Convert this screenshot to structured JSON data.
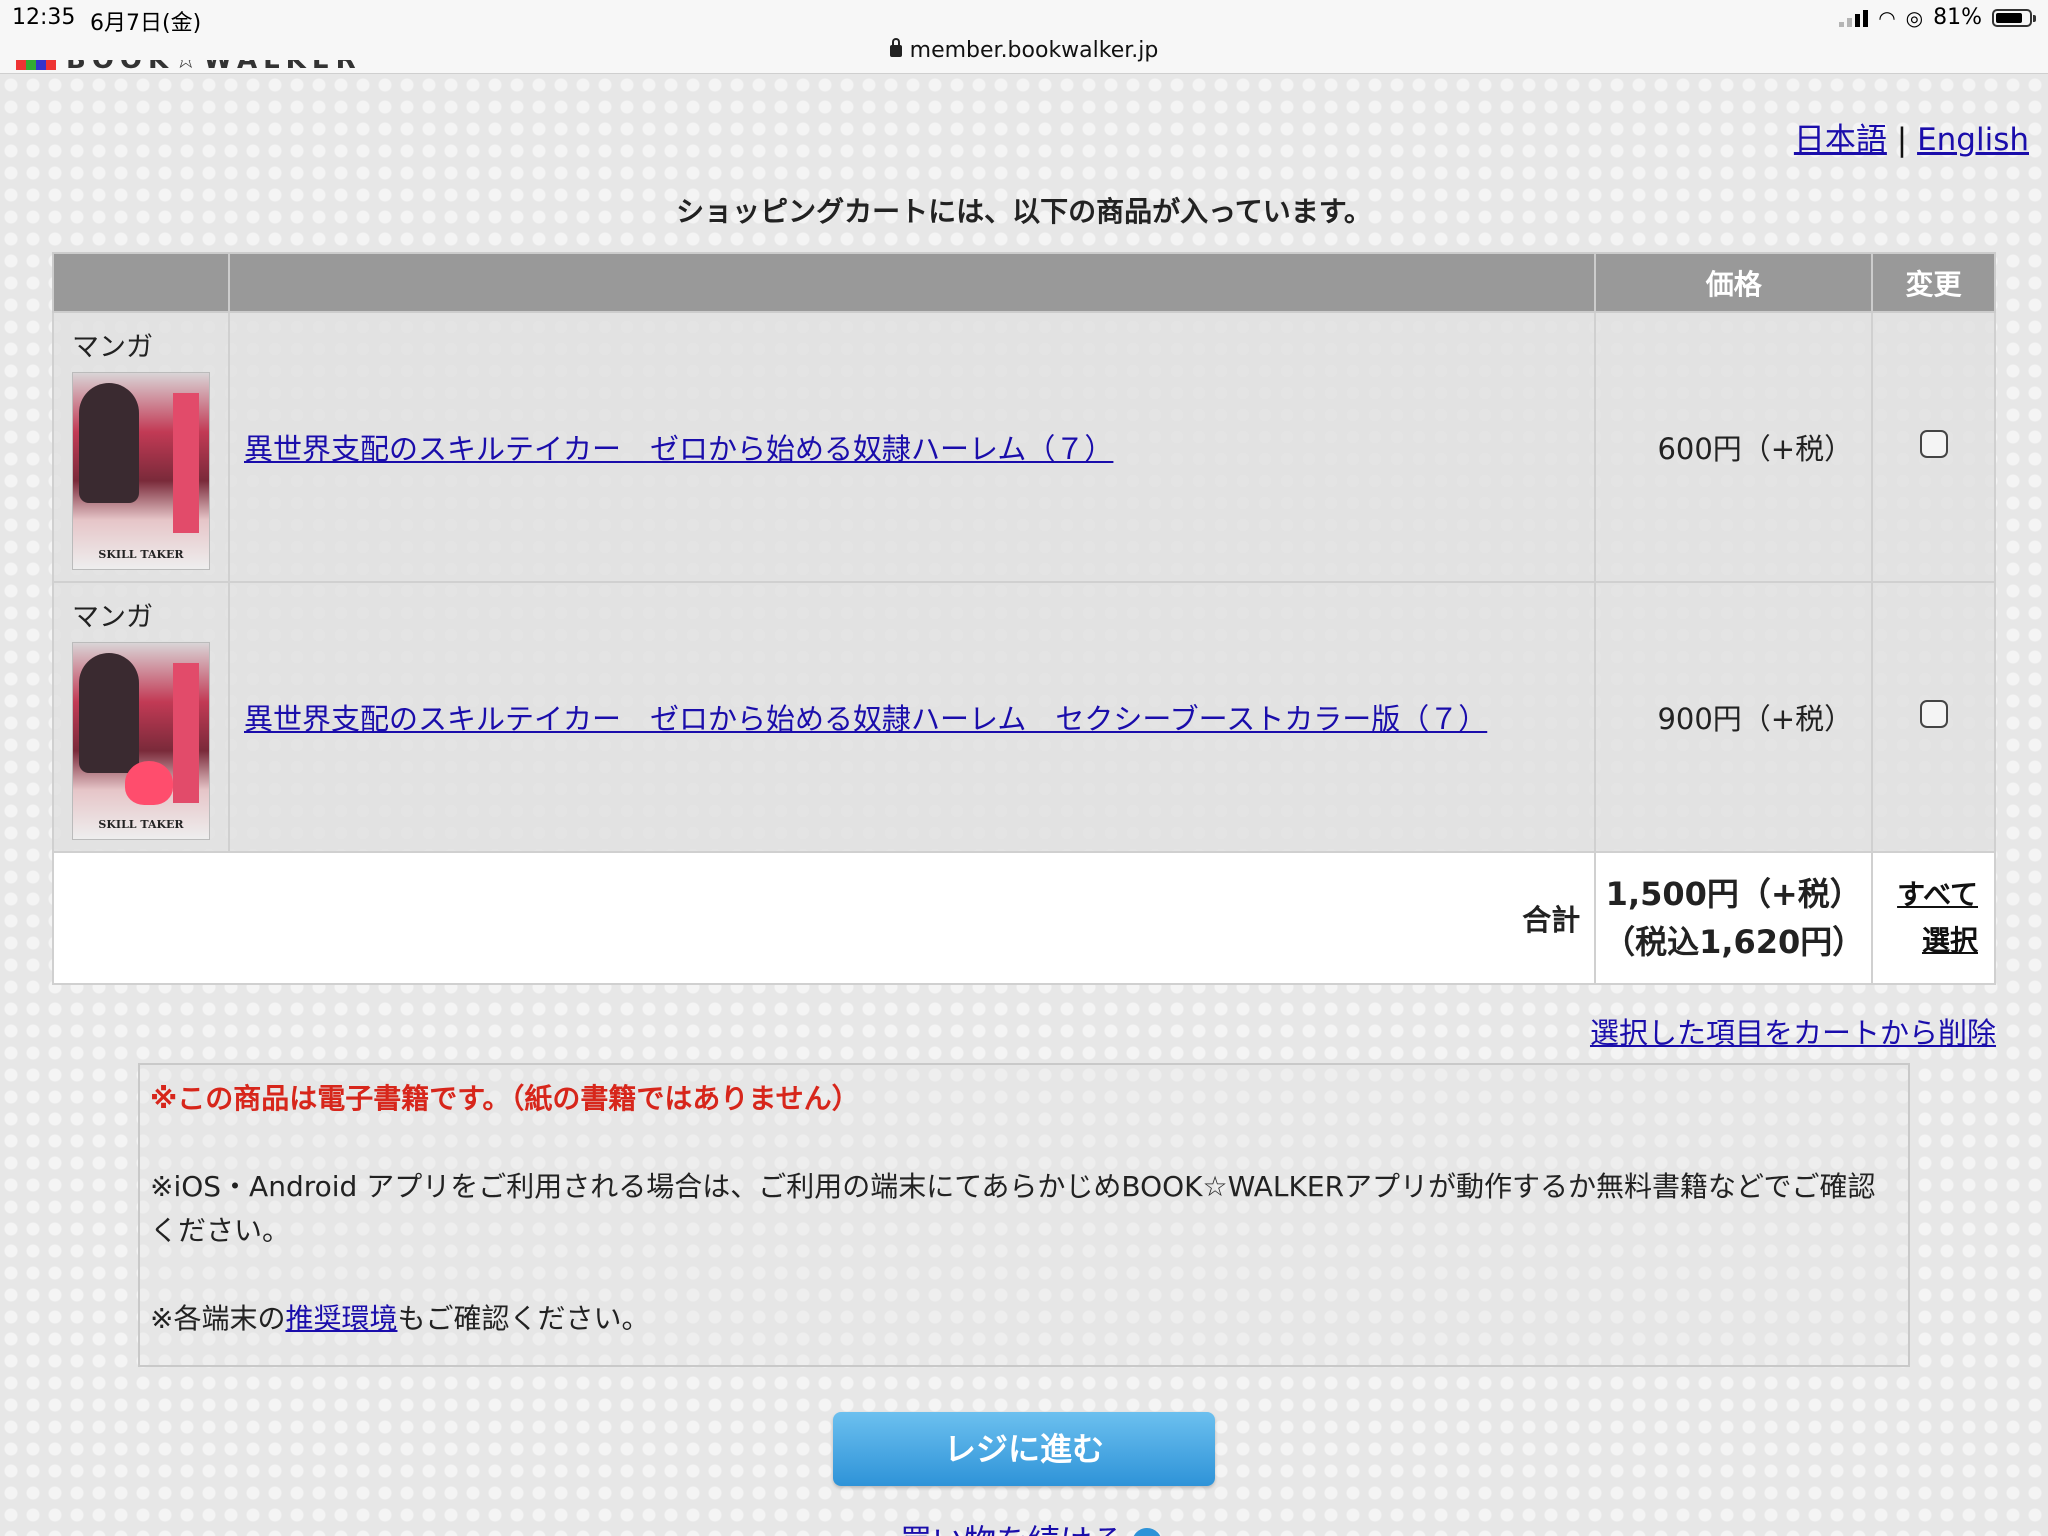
{
  "status_bar": {
    "time": "12:35",
    "date": "6月7日(金)",
    "battery": "81%",
    "battery_level": 0.81
  },
  "browser": {
    "url": "member.bookwalker.jp",
    "logo_text": "BOOK☆WALKER"
  },
  "lang": {
    "japanese": "日本語",
    "separator": "|",
    "english": "English"
  },
  "cart": {
    "heading": "ショッピングカートには、以下の商品が入っています。",
    "columns": {
      "genre": "",
      "title": "",
      "price": "価格",
      "change": "変更"
    },
    "items": [
      {
        "genre": "マンガ",
        "title": "異世界支配のスキルテイカー　ゼロから始める奴隷ハーレム（７）",
        "price": "600円（+税）",
        "cover_text": "SKILL TAKER"
      },
      {
        "genre": "マンガ",
        "title": "異世界支配のスキルテイカー　ゼロから始める奴隷ハーレム　セクシーブーストカラー版（７）",
        "price": "900円（+税）",
        "cover_text": "SKILL TAKER"
      }
    ],
    "total_label": "合計",
    "total_price": "1,500円（+税）",
    "total_price_incl": "（税込1,620円）",
    "select_all_line1": "すべて",
    "select_all_line2": "選択",
    "delete_selected": "選択した項目をカートから削除"
  },
  "notice": {
    "warning": "※この商品は電子書籍です。（紙の書籍ではありません）",
    "line1": "※iOS・Android アプリをご利用される場合は、ご利用の端末にてあらかじめBOOK☆WALKERアプリが動作するか無料書籍などでご確認ください。",
    "line2_prefix": "※各端末の",
    "line2_link": "推奨環境",
    "line2_suffix": "もご確認ください。"
  },
  "actions": {
    "checkout": "レジに進む",
    "continue_shopping": "買い物を続ける"
  },
  "colors": {
    "link": "#1a0dab",
    "warning": "#d7261b",
    "button_top": "#6cc0ef",
    "button_bottom": "#2e93d8",
    "table_header": "#999999"
  }
}
